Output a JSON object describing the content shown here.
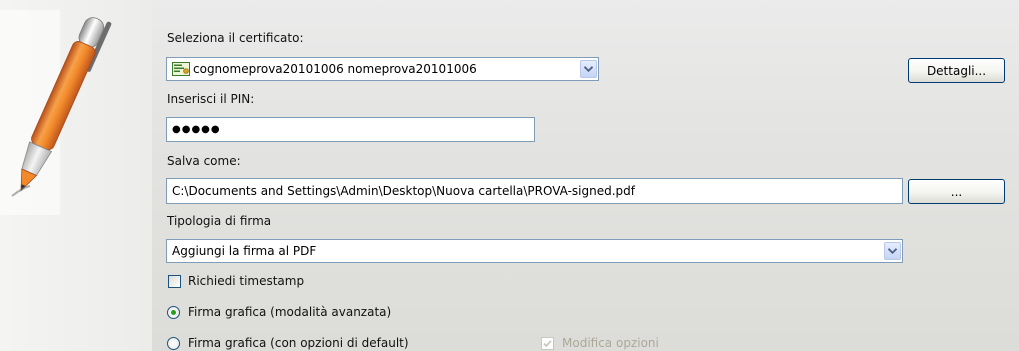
{
  "certificate": {
    "label": "Seleziona il certificato:",
    "value": "cognomeprova20101006 nomeprova20101006",
    "icon": "certificate-icon",
    "details_button": "Dettagli..."
  },
  "pin": {
    "label": "Inserisci il PIN:",
    "masked_value": "●●●●●"
  },
  "save_as": {
    "label": "Salva come:",
    "path": "C:\\Documents and Settings\\Admin\\Desktop\\Nuova cartella\\PROVA-signed.pdf",
    "browse_button": "..."
  },
  "signature_type": {
    "label": "Tipologia di firma",
    "value": "Aggiungi la firma al PDF"
  },
  "timestamp": {
    "label": "Richiedi timestamp",
    "checked": false
  },
  "graphic_signature_options": [
    {
      "label": "Firma grafica (modalità avanzata)",
      "selected": true
    },
    {
      "label": "Firma grafica (con opzioni di default)",
      "selected": false
    }
  ],
  "modify_options": {
    "label": "Modifica opzioni",
    "checked": true,
    "enabled": false
  },
  "colors": {
    "field_border": "#7f9db9",
    "button_border": "#003c74",
    "radio_selected": "#21a121",
    "pen_body": "#f28a2b"
  }
}
